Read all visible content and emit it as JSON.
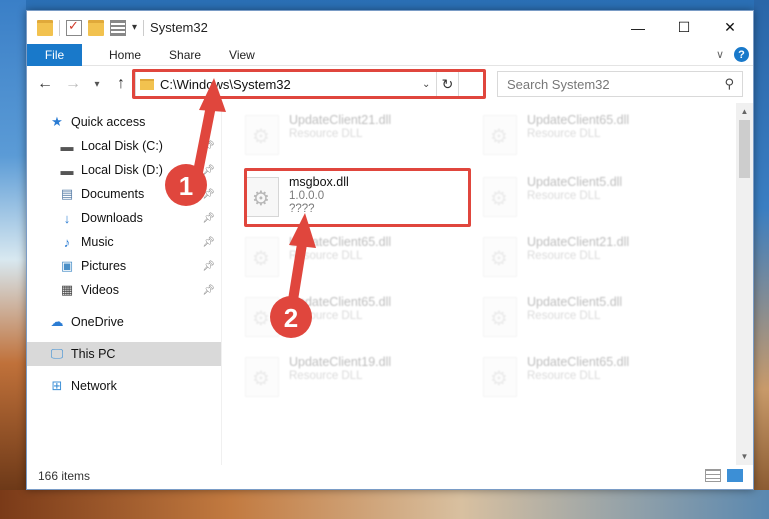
{
  "window": {
    "title": "System32",
    "controls": {
      "minimize": "—",
      "maximize": "☐",
      "close": "✕"
    }
  },
  "ribbon": {
    "tabs": [
      {
        "label": "File",
        "active": true
      },
      {
        "label": "Home"
      },
      {
        "label": "Share"
      },
      {
        "label": "View"
      }
    ],
    "help": "?"
  },
  "nav": {
    "address_path": "C:\\Windows\\System32",
    "search_placeholder": "Search System32"
  },
  "sidebar": {
    "items": [
      {
        "label": "Quick access",
        "icon": "star-icon",
        "pinned": false
      },
      {
        "label": "Local Disk (C:)",
        "icon": "drive-icon",
        "pinned": true
      },
      {
        "label": "Local Disk (D:)",
        "icon": "drive-icon",
        "pinned": true
      },
      {
        "label": "Documents",
        "icon": "documents-icon",
        "pinned": true
      },
      {
        "label": "Downloads",
        "icon": "download-icon",
        "pinned": true
      },
      {
        "label": "Music",
        "icon": "music-icon",
        "pinned": true
      },
      {
        "label": "Pictures",
        "icon": "pictures-icon",
        "pinned": true
      },
      {
        "label": "Videos",
        "icon": "videos-icon",
        "pinned": true
      },
      {
        "label": "OneDrive",
        "icon": "cloud-icon",
        "pinned": false
      },
      {
        "label": "This PC",
        "icon": "computer-icon",
        "pinned": false,
        "selected": true
      },
      {
        "label": "Network",
        "icon": "network-icon",
        "pinned": false
      }
    ]
  },
  "files": [
    {
      "name": "UpdateClient21.dll",
      "sub": "Resource DLL",
      "faded": true
    },
    {
      "name": "UpdateClient65.dll",
      "sub": "Resource DLL",
      "faded": true
    },
    {
      "name": "msgbox.dll",
      "sub": "1.0.0.0",
      "sub2": "????",
      "faded": false
    },
    {
      "name": "UpdateClient5.dll",
      "sub": "Resource DLL",
      "faded": true
    },
    {
      "name": "UpdateClient65.dll",
      "sub": "Resource DLL",
      "faded": true
    },
    {
      "name": "UpdateClient21.dll",
      "sub": "Resource DLL",
      "faded": true
    },
    {
      "name": "UpdateClient65.dll",
      "sub": "Resource DLL",
      "faded": true
    },
    {
      "name": "UpdateClient5.dll",
      "sub": "Resource DLL",
      "faded": true
    },
    {
      "name": "UpdateClient19.dll",
      "sub": "Resource DLL",
      "faded": true
    },
    {
      "name": "UpdateClient65.dll",
      "sub": "Resource DLL",
      "faded": true
    }
  ],
  "status": {
    "item_count": "166 items"
  },
  "annotations": {
    "step1": "1",
    "step2": "2",
    "color": "#e0463d"
  }
}
